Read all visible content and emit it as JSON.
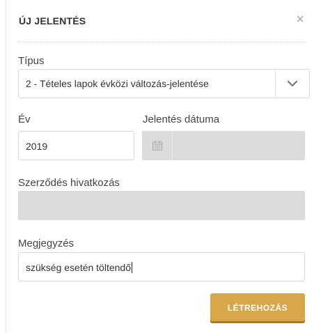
{
  "dialog": {
    "title": "ÚJ JELENTÉS",
    "close_glyph": "×"
  },
  "form": {
    "type_label": "Típus",
    "type_value": "2 - Tételes lapok évközi változás-jelentése",
    "year_label": "Év",
    "year_value": "2019",
    "report_date_label": "Jelentés dátuma",
    "report_date_value": "",
    "contract_ref_label": "Szerződés hivatkozás",
    "contract_ref_value": "",
    "note_label": "Megjegyzés",
    "note_value": "szükség esetén töltendő"
  },
  "actions": {
    "create_label": "LÉTREHOZÁS"
  },
  "colors": {
    "accent": "#d8a74a",
    "disabled_bg": "#dcdcdc"
  },
  "icons": {
    "close": "close-icon",
    "dropdown": "chevron-down-icon",
    "date": "calendar-icon"
  }
}
